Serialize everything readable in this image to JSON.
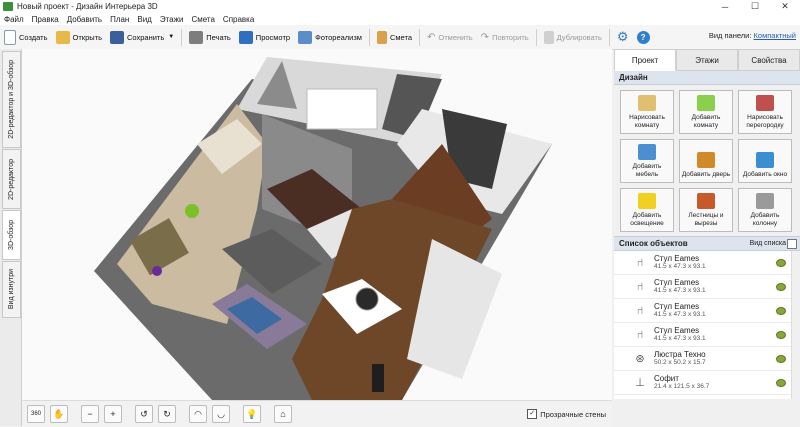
{
  "window": {
    "title": "Новый проект - Дизайн Интерьера 3D"
  },
  "menu": [
    "Файл",
    "Правка",
    "Добавить",
    "План",
    "Вид",
    "Этажи",
    "Смета",
    "Справка"
  ],
  "toolbar": {
    "create": "Создать",
    "open": "Открыть",
    "save": "Сохранить",
    "print": "Печать",
    "preview": "Просмотр",
    "photorealism": "Фотореализм",
    "estimate": "Смета",
    "undo": "Отменить",
    "redo": "Повторить",
    "duplicate": "Дублировать"
  },
  "panel_mode": {
    "label": "Вид панели:",
    "value": "Компактный"
  },
  "left_tabs": [
    "2D-редактор и 3D-обзор",
    "2D-редактор",
    "3D-обзор",
    "Вид изнутри"
  ],
  "right_panel": {
    "tabs": [
      "Проект",
      "Этажи",
      "Свойства"
    ],
    "design_header": "Дизайн",
    "design_buttons": [
      {
        "label": "Нарисовать комнату",
        "icon": "draw-room-icon",
        "color": "#e0c070"
      },
      {
        "label": "Добавить комнату",
        "icon": "add-room-icon",
        "color": "#8ccf4a"
      },
      {
        "label": "Нарисовать перегородку",
        "icon": "wall-icon",
        "color": "#c0504d"
      },
      {
        "label": "Добавить мебель",
        "icon": "furniture-icon",
        "color": "#4a90d0"
      },
      {
        "label": "Добавить дверь",
        "icon": "door-icon",
        "color": "#d08a2a"
      },
      {
        "label": "Добавить окно",
        "icon": "window-icon",
        "color": "#3a8fd0"
      },
      {
        "label": "Добавить освещение",
        "icon": "lamp-icon",
        "color": "#f0d020"
      },
      {
        "label": "Лестницы и вырезы",
        "icon": "stairs-icon",
        "color": "#c85a2a"
      },
      {
        "label": "Добавить колонну",
        "icon": "column-icon",
        "color": "#9a9a9a"
      }
    ],
    "objects_header": "Список объектов",
    "objects_view": "Вид списка",
    "objects": [
      {
        "name": "Стул Eames",
        "size": "41.5 x 47.3 x 93.1",
        "icon": "chair-icon"
      },
      {
        "name": "Стул Eames",
        "size": "41.5 x 47.3 x 93.1",
        "icon": "chair-icon"
      },
      {
        "name": "Стул Eames",
        "size": "41.5 x 47.3 x 93.1",
        "icon": "chair-icon"
      },
      {
        "name": "Стул Eames",
        "size": "41.5 x 47.3 x 93.1",
        "icon": "chair-icon"
      },
      {
        "name": "Люстра Техно",
        "size": "50.2 x 50.2 x 15.7",
        "icon": "chandelier-icon"
      },
      {
        "name": "Софит",
        "size": "21.4 x 121.5 x 36.7",
        "icon": "spotlight-icon"
      }
    ]
  },
  "bottom": {
    "transparent_walls": "Прозрачные стены",
    "button_360": "360"
  }
}
